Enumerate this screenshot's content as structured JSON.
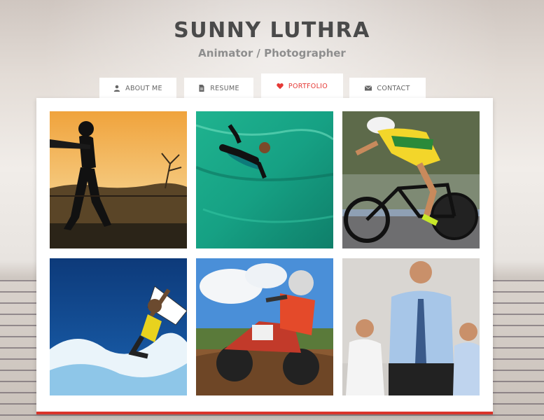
{
  "header": {
    "name": "SUNNY LUTHRA",
    "role": "Animator / Photographer"
  },
  "tabs": [
    {
      "label": "ABOUT ME",
      "icon": "user-icon",
      "active": false
    },
    {
      "label": "RESUME",
      "icon": "document-icon",
      "active": false
    },
    {
      "label": "PORTFOLIO",
      "icon": "heart-icon",
      "active": true
    },
    {
      "label": "CONTACT",
      "icon": "envelope-icon",
      "active": false
    }
  ],
  "portfolio": {
    "items": [
      {
        "subject": "cricket-batsman-silhouette"
      },
      {
        "subject": "bodyboarder"
      },
      {
        "subject": "road-cyclist"
      },
      {
        "subject": "surfer"
      },
      {
        "subject": "motocross-rider"
      },
      {
        "subject": "business-team"
      }
    ]
  },
  "colors": {
    "accent": "#e53935",
    "card_border": "#d9342b",
    "title": "#4a4a4a",
    "subtitle": "#8e8e8e"
  }
}
